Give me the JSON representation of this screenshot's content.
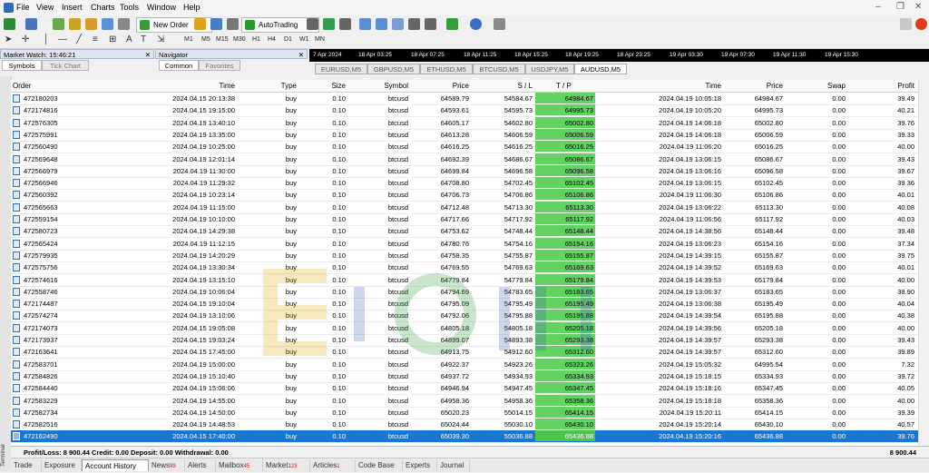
{
  "menu": [
    "File",
    "View",
    "Insert",
    "Charts",
    "Tools",
    "Window",
    "Help"
  ],
  "toolbar": {
    "new_order": "New Order",
    "autotrading": "AutoTrading"
  },
  "timeframes": [
    "M1",
    "M5",
    "M15",
    "M30",
    "H1",
    "H4",
    "D1",
    "W1",
    "MN"
  ],
  "market_watch": {
    "title": "Market Watch: 15:46:21",
    "tabs": [
      "Symbols",
      "Tick Chart"
    ]
  },
  "navigator": {
    "title": "Navigator",
    "tabs": [
      "Common",
      "Favorites"
    ]
  },
  "chart_times": [
    "7 Apr 2024",
    "18 Apr 03:25",
    "18 Apr 07:25",
    "18 Apr 11:25",
    "18 Apr 15:25",
    "18 Apr 19:25",
    "18 Apr 23:25",
    "19 Apr 03:30",
    "19 Apr 07:30",
    "19 Apr 11:30",
    "19 Apr 15:30"
  ],
  "chart_tabs": [
    "EURUSD,M5",
    "GBPUSD,M5",
    "ETHUSD,M5",
    "BTCUSD,M5",
    "USDJPY,M5",
    "AUDUSD,M5"
  ],
  "columns": [
    "Order",
    "Time",
    "Type",
    "Size",
    "Symbol",
    "Price",
    "S / L",
    "T / P",
    "Time",
    "Price",
    "Swap",
    "Profit"
  ],
  "rows": [
    {
      "order": "472180203",
      "otime": "2024.04.15 20:13:38",
      "type": "buy",
      "size": "0.10",
      "symbol": "btcusd",
      "price": "64589.79",
      "sl": "54584.67",
      "tp": "64984.67",
      "ctime": "2024.04.19 10:05:18",
      "cprice": "64984.67",
      "swap": "0.00",
      "profit": "39.49"
    },
    {
      "order": "472174816",
      "otime": "2024.04.15 19:15:00",
      "type": "buy",
      "size": "0.10",
      "symbol": "btcusd",
      "price": "64593.61",
      "sl": "54595.73",
      "tp": "64995.73",
      "ctime": "2024.04.19 10:05:20",
      "cprice": "64995.73",
      "swap": "0.00",
      "profit": "40.21"
    },
    {
      "order": "472576305",
      "otime": "2024.04.19 13:40:10",
      "type": "buy",
      "size": "0.10",
      "symbol": "btcusd",
      "price": "64605.17",
      "sl": "54602.80",
      "tp": "65002.80",
      "ctime": "2024.04.19 14:06:18",
      "cprice": "65002.80",
      "swap": "0.00",
      "profit": "39.76"
    },
    {
      "order": "472575991",
      "otime": "2024.04.19 13:35:00",
      "type": "buy",
      "size": "0.10",
      "symbol": "btcusd",
      "price": "64613.28",
      "sl": "54606.59",
      "tp": "65006.59",
      "ctime": "2024.04.19 14:06:18",
      "cprice": "65006.59",
      "swap": "0.00",
      "profit": "39.33"
    },
    {
      "order": "472560490",
      "otime": "2024.04.19 10:25:00",
      "type": "buy",
      "size": "0.10",
      "symbol": "btcusd",
      "price": "64616.25",
      "sl": "54616.25",
      "tp": "65016.25",
      "ctime": "2024.04.19 11:06:20",
      "cprice": "65016.25",
      "swap": "0.00",
      "profit": "40.00"
    },
    {
      "order": "472569648",
      "otime": "2024.04.19 12:01:14",
      "type": "buy",
      "size": "0.10",
      "symbol": "btcusd",
      "price": "64692.39",
      "sl": "54686.67",
      "tp": "65086.67",
      "ctime": "2024.04.19 13:06:15",
      "cprice": "65086.67",
      "swap": "0.00",
      "profit": "39.43"
    },
    {
      "order": "472566979",
      "otime": "2024.04.19 11:30:00",
      "type": "buy",
      "size": "0.10",
      "symbol": "btcusd",
      "price": "64699.84",
      "sl": "54696.58",
      "tp": "65096.58",
      "ctime": "2024.04.19 13:06:16",
      "cprice": "65096.58",
      "swap": "0.00",
      "profit": "39.67"
    },
    {
      "order": "472566946",
      "otime": "2024.04.19 11:29:32",
      "type": "buy",
      "size": "0.10",
      "symbol": "btcusd",
      "price": "64708.80",
      "sl": "54702.45",
      "tp": "65102.45",
      "ctime": "2024.04.19 13:06:15",
      "cprice": "65102.45",
      "swap": "0.00",
      "profit": "39.36"
    },
    {
      "order": "472560392",
      "otime": "2024.04.19 10:23:14",
      "type": "buy",
      "size": "0.10",
      "symbol": "btcusd",
      "price": "64706.73",
      "sl": "54706.86",
      "tp": "65106.86",
      "ctime": "2024.04.19 11:06:30",
      "cprice": "65106.86",
      "swap": "0.00",
      "profit": "40.01"
    },
    {
      "order": "472565663",
      "otime": "2024.04.19 11:15:00",
      "type": "buy",
      "size": "0.10",
      "symbol": "btcusd",
      "price": "64712.48",
      "sl": "54713.30",
      "tp": "65113.30",
      "ctime": "2024.04.19 13:06:22",
      "cprice": "65113.30",
      "swap": "0.00",
      "profit": "40.08"
    },
    {
      "order": "472559154",
      "otime": "2024.04.19 10:10:00",
      "type": "buy",
      "size": "0.10",
      "symbol": "btcusd",
      "price": "64717.66",
      "sl": "54717.92",
      "tp": "65117.92",
      "ctime": "2024.04.19 11:06:56",
      "cprice": "65117.92",
      "swap": "0.00",
      "profit": "40.03"
    },
    {
      "order": "472580723",
      "otime": "2024.04.19 14:29:38",
      "type": "buy",
      "size": "0.10",
      "symbol": "btcusd",
      "price": "64753.62",
      "sl": "54748.44",
      "tp": "65148.44",
      "ctime": "2024.04.19 14:38:56",
      "cprice": "65148.44",
      "swap": "0.00",
      "profit": "39.48"
    },
    {
      "order": "472565424",
      "otime": "2024.04.19 11:12:15",
      "type": "buy",
      "size": "0.10",
      "symbol": "btcusd",
      "price": "64780.76",
      "sl": "54754.16",
      "tp": "65154.16",
      "ctime": "2024.04.19 13:06:23",
      "cprice": "65154.16",
      "swap": "0.00",
      "profit": "37.34"
    },
    {
      "order": "472579935",
      "otime": "2024.04.19 14:20:29",
      "type": "buy",
      "size": "0.10",
      "symbol": "btcusd",
      "price": "64758.35",
      "sl": "54755.87",
      "tp": "65155.87",
      "ctime": "2024.04.19 14:39:15",
      "cprice": "65155.87",
      "swap": "0.00",
      "profit": "39.75"
    },
    {
      "order": "472575756",
      "otime": "2024.04.19 13:30:34",
      "type": "buy",
      "size": "0.10",
      "symbol": "btcusd",
      "price": "64769.55",
      "sl": "54769.63",
      "tp": "65169.63",
      "ctime": "2024.04.19 14:39:52",
      "cprice": "65169.63",
      "swap": "0.00",
      "profit": "40.01"
    },
    {
      "order": "472574616",
      "otime": "2024.04.19 13:15:10",
      "type": "buy",
      "size": "0.10",
      "symbol": "btcusd",
      "price": "64779.84",
      "sl": "54779.84",
      "tp": "65179.84",
      "ctime": "2024.04.19 14:39:53",
      "cprice": "65179.84",
      "swap": "0.00",
      "profit": "40.00"
    },
    {
      "order": "472558746",
      "otime": "2024.04.19 10:06:04",
      "type": "buy",
      "size": "0.10",
      "symbol": "btcusd",
      "price": "64794.69",
      "sl": "54783.65",
      "tp": "65183.65",
      "ctime": "2024.04.19 13:06:37",
      "cprice": "65183.65",
      "swap": "0.00",
      "profit": "38.90"
    },
    {
      "order": "472174487",
      "otime": "2024.04.15 19:10:04",
      "type": "buy",
      "size": "0.10",
      "symbol": "btcusd",
      "price": "64795.09",
      "sl": "54795.49",
      "tp": "65195.49",
      "ctime": "2024.04.19 13:06:38",
      "cprice": "65195.49",
      "swap": "0.00",
      "profit": "40.04"
    },
    {
      "order": "472574274",
      "otime": "2024.04.19 13:10:06",
      "type": "buy",
      "size": "0.10",
      "symbol": "btcusd",
      "price": "64792.06",
      "sl": "54795.88",
      "tp": "65195.88",
      "ctime": "2024.04.19 14:39:54",
      "cprice": "65195.88",
      "swap": "0.00",
      "profit": "40.38"
    },
    {
      "order": "472174073",
      "otime": "2024.04.15 19:05:08",
      "type": "buy",
      "size": "0.10",
      "symbol": "btcusd",
      "price": "64805.18",
      "sl": "54805.18",
      "tp": "65205.18",
      "ctime": "2024.04.19 14:39:56",
      "cprice": "65205.18",
      "swap": "0.00",
      "profit": "40.00"
    },
    {
      "order": "472173937",
      "otime": "2024.04.15 19:03:24",
      "type": "buy",
      "size": "0.10",
      "symbol": "btcusd",
      "price": "64899.07",
      "sl": "54893.38",
      "tp": "65293.38",
      "ctime": "2024.04.19 14:39:57",
      "cprice": "65293.38",
      "swap": "0.00",
      "profit": "39.43"
    },
    {
      "order": "472163641",
      "otime": "2024.04.15 17:45:00",
      "type": "buy",
      "size": "0.10",
      "symbol": "btcusd",
      "price": "64913.75",
      "sl": "54912.60",
      "tp": "65312.60",
      "ctime": "2024.04.19 14:39:57",
      "cprice": "65312.60",
      "swap": "0.00",
      "profit": "39.89"
    },
    {
      "order": "472583701",
      "otime": "2024.04.19 15:00:00",
      "type": "buy",
      "size": "0.10",
      "symbol": "btcusd",
      "price": "64922.37",
      "sl": "54923.26",
      "tp": "65323.26",
      "ctime": "2024.04.19 15:05:32",
      "cprice": "64995.54",
      "swap": "0.00",
      "profit": "7.32"
    },
    {
      "order": "472584826",
      "otime": "2024.04.19 15:10:40",
      "type": "buy",
      "size": "0.10",
      "symbol": "btcusd",
      "price": "64937.72",
      "sl": "54934.93",
      "tp": "65334.93",
      "ctime": "2024.04.19 15:18:15",
      "cprice": "65334.93",
      "swap": "0.00",
      "profit": "39.72"
    },
    {
      "order": "472584440",
      "otime": "2024.04.19 15:06:06",
      "type": "buy",
      "size": "0.10",
      "symbol": "btcusd",
      "price": "64946.94",
      "sl": "54947.45",
      "tp": "65347.45",
      "ctime": "2024.04.19 15:18:16",
      "cprice": "65347.45",
      "swap": "0.00",
      "profit": "40.05"
    },
    {
      "order": "472583229",
      "otime": "2024.04.19 14:55:00",
      "type": "buy",
      "size": "0.10",
      "symbol": "btcusd",
      "price": "64958.36",
      "sl": "54958.36",
      "tp": "65358.36",
      "ctime": "2024.04.19 15:18:18",
      "cprice": "65358.36",
      "swap": "0.00",
      "profit": "40.00"
    },
    {
      "order": "472582734",
      "otime": "2024.04.19 14:50:00",
      "type": "buy",
      "size": "0.10",
      "symbol": "btcusd",
      "price": "65020.23",
      "sl": "55014.15",
      "tp": "65414.15",
      "ctime": "2024.04.19 15:20:11",
      "cprice": "65414.15",
      "swap": "0.00",
      "profit": "39.39"
    },
    {
      "order": "472582516",
      "otime": "2024.04.19 14:48:53",
      "type": "buy",
      "size": "0.10",
      "symbol": "btcusd",
      "price": "65024.44",
      "sl": "55030.10",
      "tp": "65430.10",
      "ctime": "2024.04.19 15:20:14",
      "cprice": "65430.10",
      "swap": "0.00",
      "profit": "40.57"
    },
    {
      "order": "472162490",
      "otime": "2024.04.15 17:40:00",
      "type": "buy",
      "size": "0.10",
      "symbol": "btcusd",
      "price": "65039.30",
      "sl": "55036.88",
      "tp": "65436.88",
      "ctime": "2024.04.19 15:20:16",
      "cprice": "65436.88",
      "swap": "0.00",
      "profit": "39.76"
    }
  ],
  "summary": {
    "text": "Profit/Loss: 8 900.44  Credit: 0.00  Deposit: 0.00  Withdrawal: 0.00",
    "total": "8 900.44"
  },
  "bottom_tabs": [
    {
      "label": "Trade",
      "badge": ""
    },
    {
      "label": "Exposure",
      "badge": ""
    },
    {
      "label": "Account History",
      "badge": ""
    },
    {
      "label": "News",
      "badge": "99"
    },
    {
      "label": "Alerts",
      "badge": ""
    },
    {
      "label": "Mailbox",
      "badge": "45"
    },
    {
      "label": "Market",
      "badge": "123"
    },
    {
      "label": "Articles",
      "badge": "1"
    },
    {
      "label": "Code Base",
      "badge": ""
    },
    {
      "label": "Experts",
      "badge": ""
    },
    {
      "label": "Journal",
      "badge": ""
    }
  ],
  "terminal_label": "Terminal",
  "colors": {
    "tp_highlight": "#62d262",
    "selected_row": "#1976d2"
  }
}
